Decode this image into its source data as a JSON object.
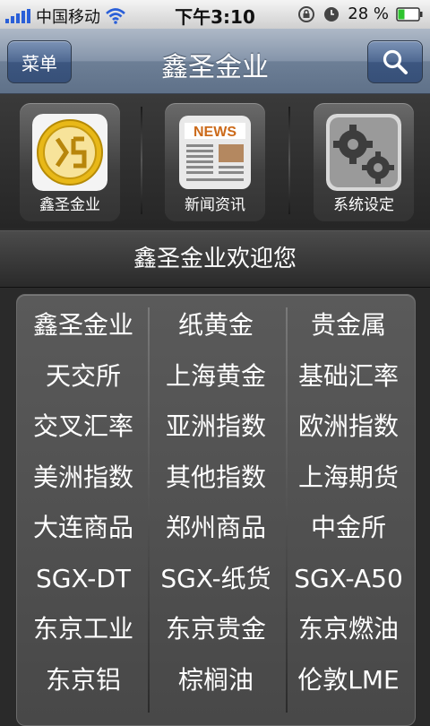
{
  "status_bar": {
    "carrier": "中国移动",
    "time": "下午3:10",
    "battery": "28 %"
  },
  "nav": {
    "menu_label": "菜单",
    "title": "鑫圣金业",
    "search_icon": "search-icon"
  },
  "tiles": [
    {
      "label": "鑫圣金业",
      "icon": "xinsheng-logo-icon"
    },
    {
      "label": "新闻资讯",
      "icon": "newspaper-icon",
      "icon_text": "NEWS"
    },
    {
      "label": "系统设定",
      "icon": "gear-icon"
    }
  ],
  "welcome": "鑫圣金业欢迎您",
  "grid": [
    [
      "鑫圣金业",
      "纸黄金",
      "贵金属"
    ],
    [
      "天交所",
      "上海黄金",
      "基础汇率"
    ],
    [
      "交叉汇率",
      "亚洲指数",
      "欧洲指数"
    ],
    [
      "美洲指数",
      "其他指数",
      "上海期货"
    ],
    [
      "大连商品",
      "郑州商品",
      "中金所"
    ],
    [
      "SGX-DT",
      "SGX-纸货",
      "SGX-A50"
    ],
    [
      "东京工业",
      "东京贵金",
      "东京燃油"
    ],
    [
      "东京铝",
      "棕榈油",
      "伦敦LME"
    ]
  ],
  "colors": {
    "nav_button": "#3c5680",
    "signal_bars": "#2a5fd8",
    "logo_gold": "#e8b818",
    "battery_fill": "#2fc42f"
  }
}
